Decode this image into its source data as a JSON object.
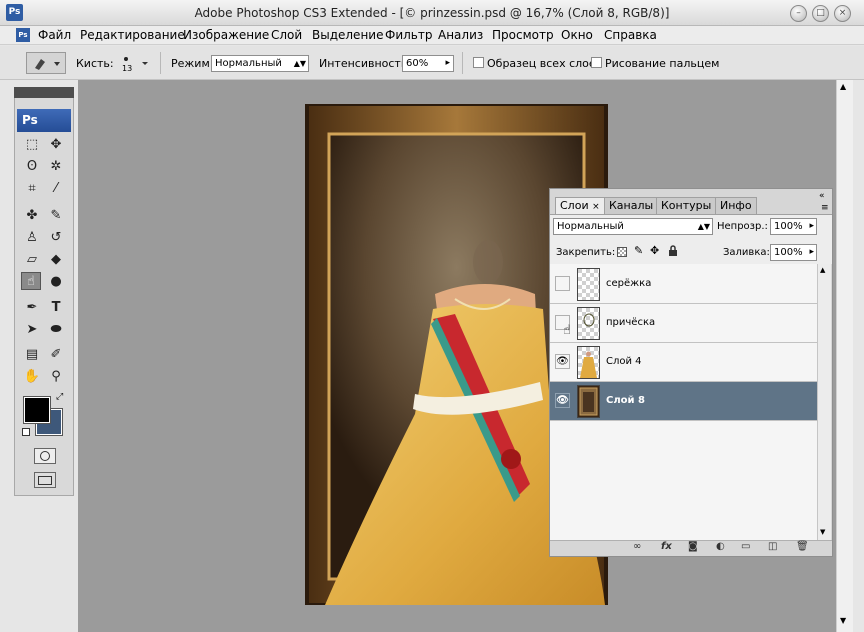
{
  "window": {
    "title": "Adobe Photoshop CS3 Extended - [© prinzessin.psd @ 16,7% (Слой 8, RGB/8)]",
    "app_icon": "Ps",
    "minimize_glyph": "–",
    "maximize_glyph": "□",
    "close_glyph": "×"
  },
  "menu": {
    "icon": "Ps",
    "items": [
      "Файл",
      "Редактирование",
      "Изображение",
      "Слой",
      "Выделение",
      "Фильтр",
      "Анализ",
      "Просмотр",
      "Окно",
      "Справка"
    ]
  },
  "options": {
    "brush_label": "Кисть:",
    "brush_size": "13",
    "mode_label": "Режим:",
    "mode_value": "Нормальный",
    "strength_label": "Интенсивность:",
    "strength_value": "60%",
    "sample_all_label": "Образец всех слоев",
    "finger_painting_label": "Рисование пальцем"
  },
  "tools": {
    "logo": "Ps",
    "icons": [
      "marquee-icon",
      "move-icon",
      "lasso-icon",
      "magic-wand-icon",
      "crop-icon",
      "slice-icon",
      "healing-icon",
      "brush-icon",
      "stamp-icon",
      "history-brush-icon",
      "eraser-icon",
      "paint-bucket-icon",
      "smudge-icon",
      "dodge-icon",
      "pen-icon",
      "type-icon",
      "path-select-icon",
      "ellipse-icon",
      "notes-icon",
      "eyedropper-icon",
      "hand-icon",
      "zoom-icon"
    ],
    "type_glyph": "T",
    "foreground_color": "#000000",
    "background_color": "#3e587a"
  },
  "layers_panel": {
    "tabs": [
      "Слои",
      "Каналы",
      "Контуры",
      "Инфо"
    ],
    "tab_close_glyph": "×",
    "blend_mode": "Нормальный",
    "opacity_label": "Непрозр.:",
    "opacity_value": "100%",
    "lock_label": "Закрепить:",
    "fill_label": "Заливка:",
    "fill_value": "100%",
    "eye_glyph": "👁",
    "layers": [
      {
        "name": "серёжка",
        "visible": false,
        "selected": false
      },
      {
        "name": "причёска",
        "visible": false,
        "selected": false
      },
      {
        "name": "Слой 4",
        "visible": true,
        "selected": false
      },
      {
        "name": "Слой 8",
        "visible": true,
        "selected": true
      }
    ],
    "footer_icons": [
      "link-icon",
      "fx-icon",
      "mask-icon",
      "adjustment-icon",
      "group-folder-icon",
      "new-layer-icon",
      "trash-icon"
    ]
  },
  "colors": {
    "selected_layer": "#5f7487",
    "gown": "#e8b848",
    "sash_red": "#c8282e",
    "sash_teal": "#3a9a8a",
    "frame_gold": "#8a5a26"
  }
}
